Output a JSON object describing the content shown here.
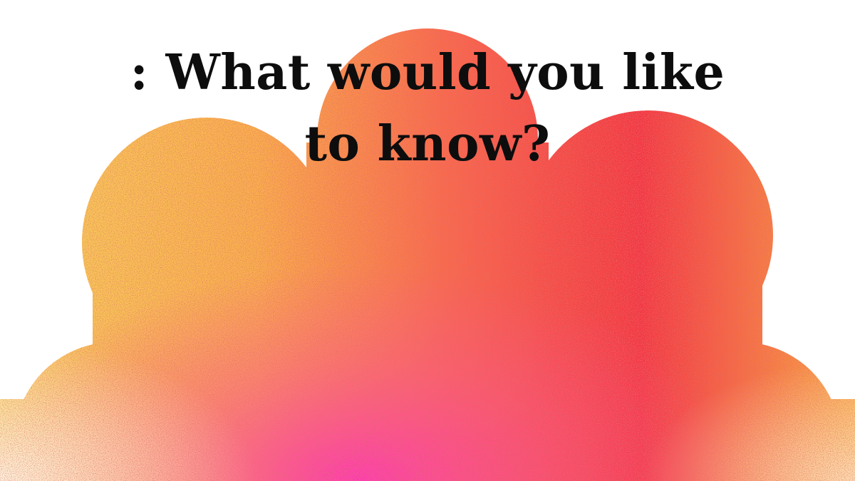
{
  "headline": {
    "line1": ": What would you like",
    "line2": "to know?"
  },
  "artwork": {
    "name": "cloud-shape",
    "gradient_colors": [
      "#f9c74f",
      "#fb923c",
      "#f43f5e",
      "#ff3fa4",
      "#fde68a"
    ],
    "background_color": "#ffffff"
  }
}
